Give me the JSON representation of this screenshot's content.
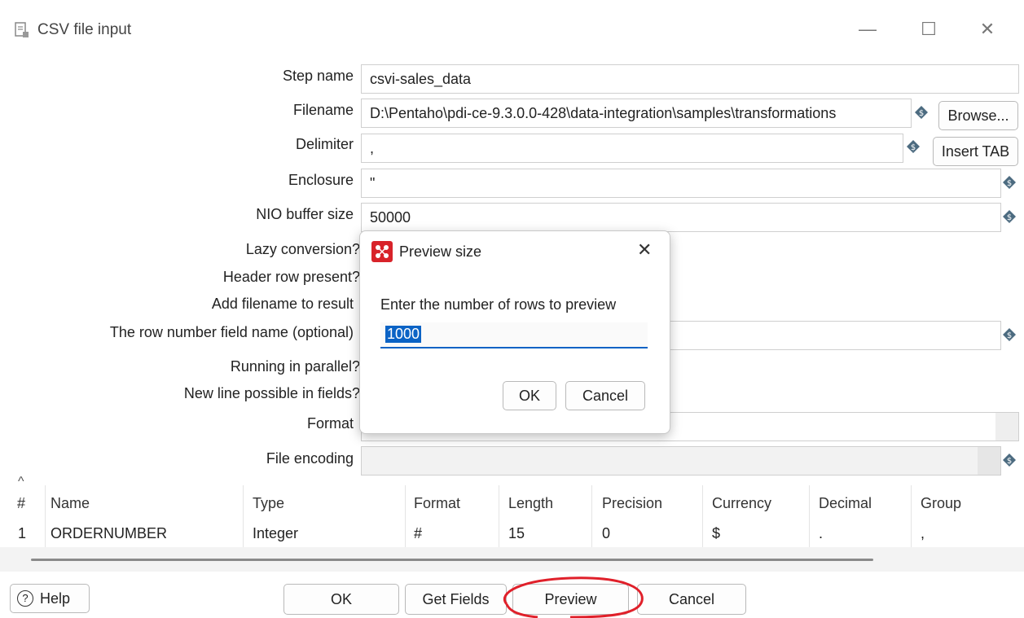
{
  "window": {
    "title": "CSV file input",
    "minimize_glyph": "—",
    "maximize_glyph": "☐",
    "close_glyph": "✕"
  },
  "form": {
    "step_name_label": "Step name",
    "step_name_value": "csvi-sales_data",
    "filename_label": "Filename",
    "filename_value": "D:\\Pentaho\\pdi-ce-9.3.0.0-428\\data-integration\\samples\\transformations",
    "browse_label": "Browse...",
    "delimiter_label": "Delimiter",
    "delimiter_value": ",",
    "insert_tab_label": "Insert TAB",
    "enclosure_label": "Enclosure",
    "enclosure_value": "\"",
    "nio_label": "NIO buffer size",
    "nio_value": "50000",
    "lazy_label": "Lazy conversion?",
    "header_label": "Header row present?",
    "add_filename_label": "Add filename to result",
    "row_number_label": "The row number field name (optional)",
    "parallel_label": "Running in parallel?",
    "newline_label": "New line possible in fields?",
    "format_label": "Format",
    "encoding_label": "File encoding"
  },
  "table": {
    "sort_glyph": "^",
    "columns": [
      "#",
      "Name",
      "Type",
      "Format",
      "Length",
      "Precision",
      "Currency",
      "Decimal",
      "Group"
    ],
    "rows": [
      [
        "1",
        "ORDERNUMBER",
        "Integer",
        "#",
        "15",
        "0",
        "$",
        ".",
        ","
      ]
    ]
  },
  "buttons": {
    "help": "Help",
    "help_glyph": "?",
    "ok": "OK",
    "get_fields": "Get Fields",
    "preview": "Preview",
    "cancel": "Cancel"
  },
  "dialog": {
    "title": "Preview size",
    "close_glyph": "✕",
    "prompt": "Enter the number of rows to preview",
    "rows_value": "1000",
    "ok": "OK",
    "cancel": "Cancel"
  },
  "colors": {
    "annotation_red": "#e0202a",
    "selection_blue": "#0b63c5",
    "variable_icon": "#4c6b80",
    "dialog_icon_red": "#d8232a"
  }
}
